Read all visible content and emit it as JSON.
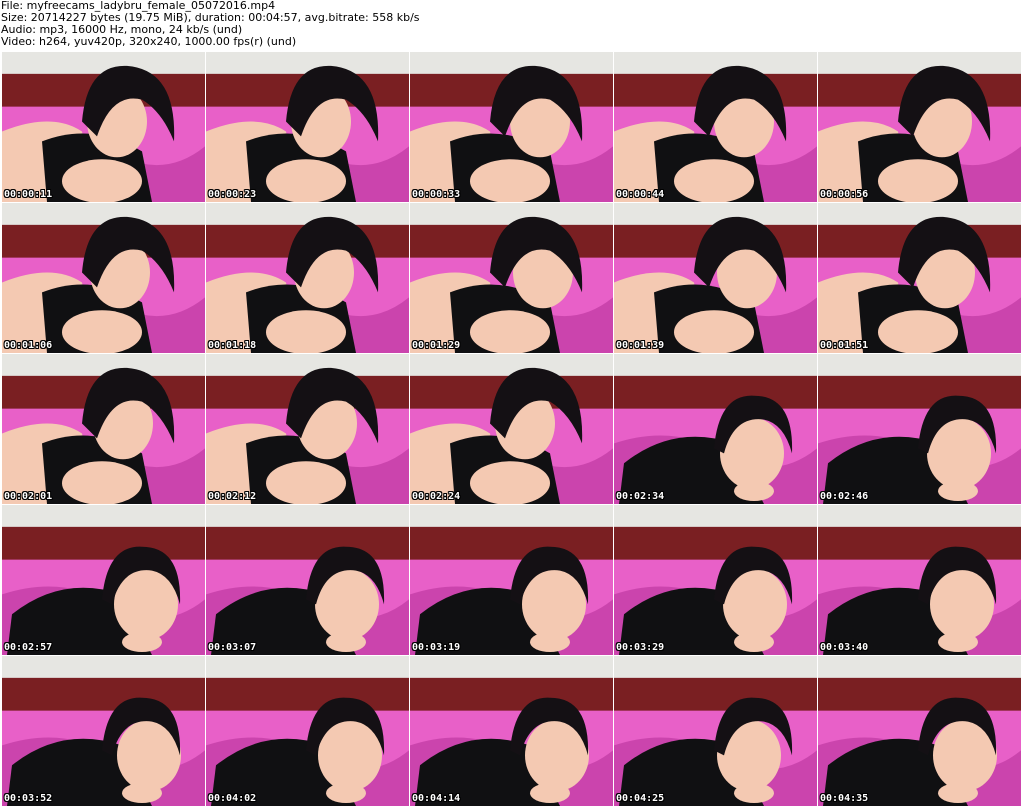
{
  "info": {
    "file": "File: myfreecams_ladybru_female_05072016.mp4",
    "size": "Size: 20714227 bytes (19.75 MiB), duration: 00:04:57, avg.bitrate: 558 kb/s",
    "audio": "Audio: mp3, 16000 Hz, mono, 24 kb/s (und)",
    "video": "Video: h264, yuv420p, 320x240, 1000.00 fps(r) (und)"
  },
  "thumbnails": [
    {
      "timestamp": "00:00:11",
      "scene": "lying"
    },
    {
      "timestamp": "00:00:23",
      "scene": "lying"
    },
    {
      "timestamp": "00:00:33",
      "scene": "lying"
    },
    {
      "timestamp": "00:00:44",
      "scene": "lying"
    },
    {
      "timestamp": "00:00:56",
      "scene": "lying"
    },
    {
      "timestamp": "00:01:06",
      "scene": "lying"
    },
    {
      "timestamp": "00:01:18",
      "scene": "lying"
    },
    {
      "timestamp": "00:01:29",
      "scene": "lying"
    },
    {
      "timestamp": "00:01:39",
      "scene": "lying"
    },
    {
      "timestamp": "00:01:51",
      "scene": "lying"
    },
    {
      "timestamp": "00:02:01",
      "scene": "lying"
    },
    {
      "timestamp": "00:02:12",
      "scene": "lying"
    },
    {
      "timestamp": "00:02:24",
      "scene": "lying"
    },
    {
      "timestamp": "00:02:34",
      "scene": "prone"
    },
    {
      "timestamp": "00:02:46",
      "scene": "prone"
    },
    {
      "timestamp": "00:02:57",
      "scene": "prone"
    },
    {
      "timestamp": "00:03:07",
      "scene": "prone"
    },
    {
      "timestamp": "00:03:19",
      "scene": "prone"
    },
    {
      "timestamp": "00:03:29",
      "scene": "prone"
    },
    {
      "timestamp": "00:03:40",
      "scene": "prone"
    },
    {
      "timestamp": "00:03:52",
      "scene": "prone"
    },
    {
      "timestamp": "00:04:02",
      "scene": "prone"
    },
    {
      "timestamp": "00:04:14",
      "scene": "prone"
    },
    {
      "timestamp": "00:04:25",
      "scene": "prone"
    },
    {
      "timestamp": "00:04:35",
      "scene": "prone"
    }
  ],
  "colors": {
    "background": "#ffffff",
    "wall": "#e6e6e2",
    "headboard": "#7a1f22",
    "bedding": "#e860c8",
    "bedding_shadow": "#a8248c",
    "skin": "#f4c9b2",
    "hair": "#141014",
    "top": "#101012",
    "timestamp_text": "#ffffff"
  }
}
